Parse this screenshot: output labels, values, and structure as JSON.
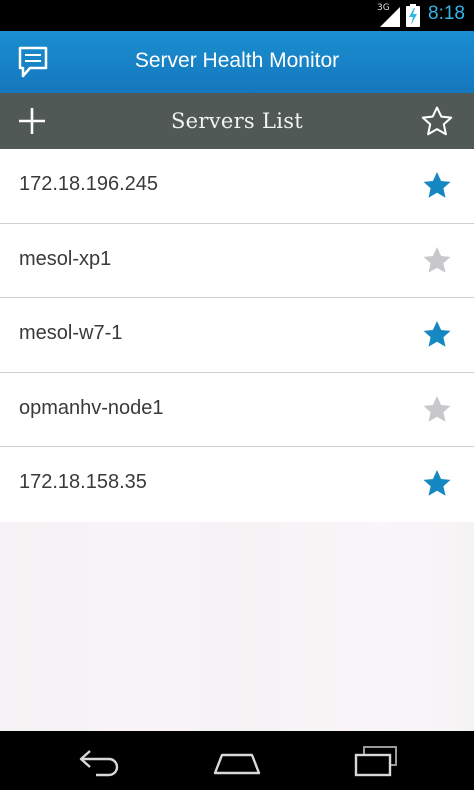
{
  "status_bar": {
    "network_label": "3G",
    "time": "8:18",
    "accent_color": "#33b5e5"
  },
  "header": {
    "title": "Server Health Monitor",
    "icon": "chat-bubble-icon"
  },
  "toolbar": {
    "title": "Servers List",
    "add_icon": "plus-icon",
    "favorites_icon": "star-outline-icon"
  },
  "servers": [
    {
      "name": "172.18.196.245",
      "favorite": true
    },
    {
      "name": "mesol-xp1",
      "favorite": false
    },
    {
      "name": "mesol-w7-1",
      "favorite": true
    },
    {
      "name": "opmanhv-node1",
      "favorite": false
    },
    {
      "name": "172.18.158.35",
      "favorite": true
    }
  ],
  "colors": {
    "header_blue": "#1a8fd0",
    "toolbar_gray": "#505955",
    "star_active": "#1588c2",
    "star_inactive": "#c8c8cc"
  },
  "nav": {
    "back_icon": "back-arrow-icon",
    "home_icon": "home-icon",
    "recent_icon": "recent-apps-icon"
  }
}
